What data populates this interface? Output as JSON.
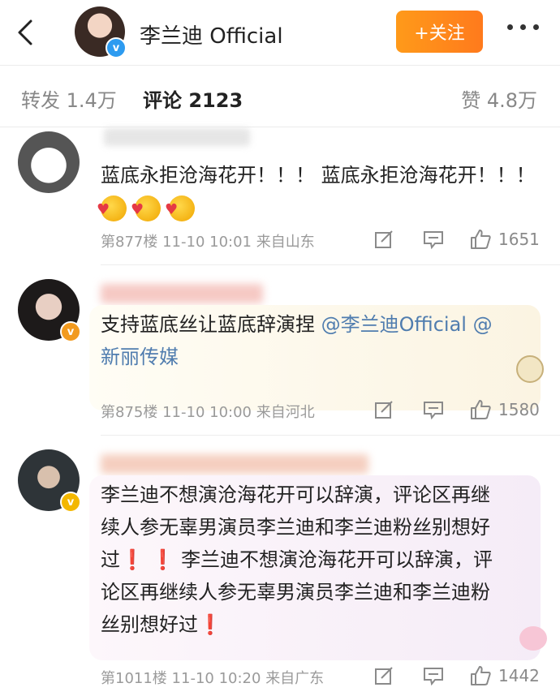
{
  "header": {
    "title": "李兰迪 Official",
    "follow_label": "+关注"
  },
  "tabs": {
    "repost": "转发 1.4万",
    "comments": "评论 2123",
    "likes": "赞 4.8万"
  },
  "comments": [
    {
      "text": "蓝底永拒沧海花开！！！ 蓝底永拒沧海花开！！！",
      "floor": "第877楼",
      "time": "11-10 10:01",
      "location": "来自山东",
      "likes": "1651"
    },
    {
      "text_pre": "支持蓝底丝让蓝底辞演捏",
      "mention1": "@李兰迪Official",
      "mention2": "@",
      "text_line2": "新丽传媒",
      "floor": "第875楼",
      "time": "11-10 10:00",
      "location": "来自河北",
      "likes": "1580"
    },
    {
      "line1": "李兰迪不想演沧海花开可以辞演，评论区再继",
      "line2": "续人参无辜男演员李兰迪和李兰迪粉丝别想好",
      "line3": "过",
      "line3b": "李兰迪不想演沧海花开可以辞演，评",
      "line4": "论区再继续人参无辜男演员李兰迪和李兰迪粉",
      "line5": "丝别想好过",
      "bang": "❗",
      "floor": "第1011楼",
      "time": "11-10 10:20",
      "location": "来自广东",
      "likes": "1442"
    }
  ]
}
